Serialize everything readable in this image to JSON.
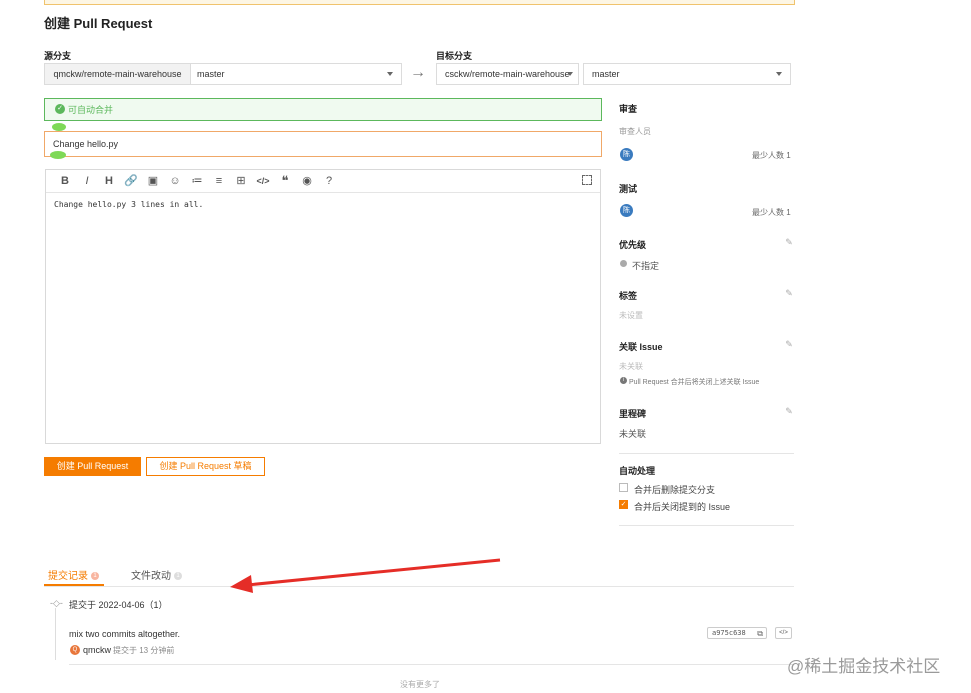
{
  "page_title": "创建 Pull Request",
  "source": {
    "label": "源分支",
    "repo": "qmckw/remote-main-warehouse",
    "branch": "master"
  },
  "target": {
    "label": "目标分支",
    "repo": "csckw/remote-main-warehouse",
    "branch": "master"
  },
  "arrow": "→",
  "merge_status": "可自动合并",
  "pr_title_value": "Change hello.py",
  "editor": {
    "toolbar": [
      "B",
      "I",
      "H",
      "🔗",
      "▣",
      "☺",
      "≔",
      "≡",
      "⊞",
      "</>",
      "❝",
      "◉",
      "?"
    ],
    "body": "Change hello.py 3 lines in all."
  },
  "buttons": {
    "create": "创建 Pull Request",
    "create_draft": "创建 Pull Request 草稿"
  },
  "sidebar": {
    "review": {
      "title": "审查",
      "sub": "审查人员",
      "avatar": "陈",
      "min": "最少人数 1"
    },
    "test": {
      "title": "测试",
      "avatar": "陈",
      "min": "最少人数 1"
    },
    "priority": {
      "title": "优先级",
      "value": "不指定"
    },
    "labels": {
      "title": "标签",
      "value": "未设置"
    },
    "issue": {
      "title": "关联 Issue",
      "value": "未关联",
      "note": "Pull Request 合并后将关闭上述关联 Issue"
    },
    "milestone": {
      "title": "里程碑",
      "value": "未关联"
    },
    "auto": {
      "title": "自动处理",
      "opt1": "合并后删除提交分支",
      "opt1_checked": false,
      "opt2": "合并后关闭提到的 Issue",
      "opt2_checked": true
    }
  },
  "tabs": {
    "commits": {
      "label": "提交记录",
      "count": "1"
    },
    "files": {
      "label": "文件改动",
      "count": "1"
    }
  },
  "commit_group": "提交于 2022-04-06（1）",
  "commit": {
    "message": "mix two commits altogether.",
    "avatar": "Q",
    "author": "qmckw",
    "time": "提交于 13 分钟前",
    "sha": "a975c638"
  },
  "no_more": "没有更多了",
  "watermark": "@稀土掘金技术社区",
  "colors": {
    "accent": "#f57c00",
    "success": "#5cb85c",
    "avatar": "#3a7bbf",
    "arrow": "#e52d27"
  }
}
